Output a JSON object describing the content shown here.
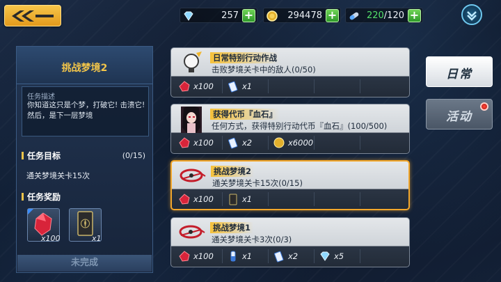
{
  "topbar": {
    "resources": [
      {
        "icon": "gem-icon",
        "value": "257"
      },
      {
        "icon": "coin-icon",
        "value": "294478"
      },
      {
        "icon": "energy-capsule-icon",
        "value": "220",
        "max": "/120"
      }
    ]
  },
  "left_panel": {
    "title": "挑战梦境2",
    "desc_label": "任务描述",
    "description": "你知道这只是个梦，打破它! 击溃它! 然后，是下一层梦境",
    "goal_header": "任务目标",
    "progress": "(0/15)",
    "goal_text": "通关梦境关卡15次",
    "reward_header": "任务奖励",
    "rewards": [
      {
        "icon": "red-crystal-icon",
        "count": "x100"
      },
      {
        "icon": "tarot-card-icon",
        "count": "x1"
      }
    ],
    "status_button": "未完成"
  },
  "tasks": [
    {
      "name": "日常特别行动作战",
      "desc": "击败梦境关卡中的敌人(0/50)",
      "icon": "lightbulb-icon",
      "rewards": [
        {
          "icon": "red-crystal-icon",
          "count": "x100"
        },
        {
          "icon": "ticket-icon",
          "count": "x1"
        }
      ]
    },
    {
      "name": "获得代币『血石』",
      "desc": "任何方式，获得特别行动代币『血石』(100/500)",
      "icon": "character-portrait-icon",
      "rewards": [
        {
          "icon": "red-crystal-icon",
          "count": "x100"
        },
        {
          "icon": "ticket-icon",
          "count": "x2"
        },
        {
          "icon": "coin-icon",
          "count": "x6000"
        }
      ]
    },
    {
      "name": "挑战梦境2",
      "desc": "通关梦境关卡15次(0/15)",
      "icon": "dream-ring-icon",
      "selected": true,
      "rewards": [
        {
          "icon": "red-crystal-icon",
          "count": "x100"
        },
        {
          "icon": "tarot-card-icon",
          "count": "x1"
        }
      ]
    },
    {
      "name": "挑战梦境1",
      "desc": "通关梦境关卡3次(0/3)",
      "icon": "dream-ring-icon",
      "rewards": [
        {
          "icon": "red-crystal-icon",
          "count": "x100"
        },
        {
          "icon": "vial-icon",
          "count": "x1"
        },
        {
          "icon": "ticket-icon",
          "count": "x2"
        },
        {
          "icon": "gem-icon",
          "count": "x5"
        }
      ]
    }
  ],
  "tabs": [
    {
      "label": "日常",
      "active": true
    },
    {
      "label": "活动",
      "active": false,
      "notification": true
    }
  ],
  "colors": {
    "accent": "#f2c54a",
    "selected_border": "#f3a72b",
    "plus_green": "#3fb536"
  }
}
